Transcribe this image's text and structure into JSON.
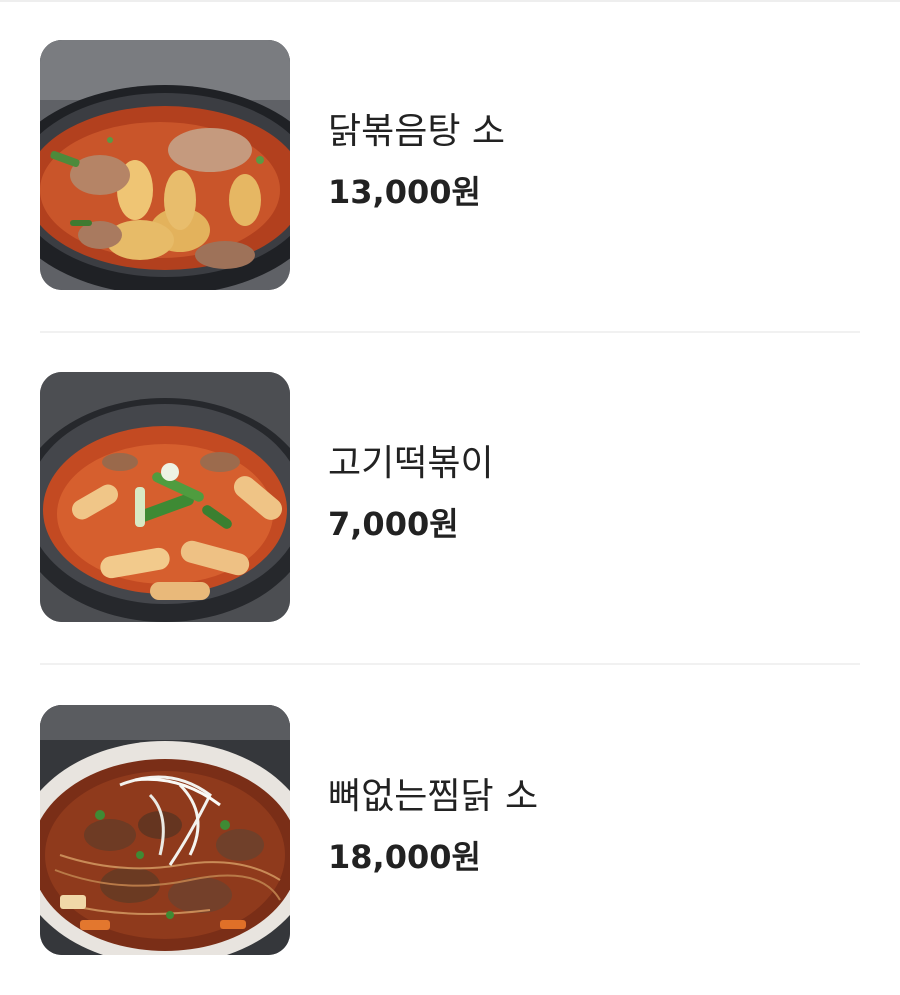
{
  "menu": {
    "items": [
      {
        "name": "닭볶음탕 소",
        "price": "13,000원",
        "image_icon": "dakbokkeumtang-photo"
      },
      {
        "name": "고기떡볶이",
        "price": "7,000원",
        "image_icon": "gogi-tteokbokki-photo"
      },
      {
        "name": "뼈없는찜닭 소",
        "price": "18,000원",
        "image_icon": "boneless-jjimdak-photo"
      }
    ]
  },
  "colors": {
    "text": "#222222",
    "divider": "#f1f1f1",
    "background": "#ffffff",
    "sauce": "#c8431f",
    "pan": "#2b2d31"
  }
}
